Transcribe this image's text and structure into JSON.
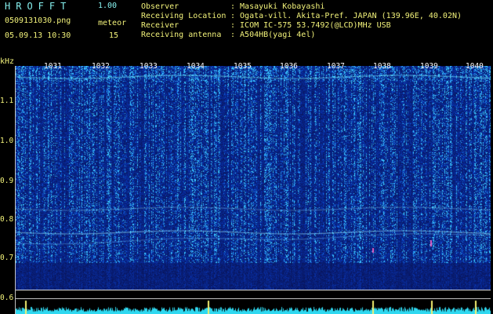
{
  "header": {
    "title": "HROFFT",
    "version": "1.00",
    "filename": "0509131030.png",
    "meteor_label": "meteor",
    "datetime": "05.09.13 10:30",
    "meteor_count": "15"
  },
  "info": {
    "observer_label": "Observer",
    "observer_value": ": Masayuki Kobayashi",
    "location_label": "Receiving Location",
    "location_value": ": Ogata-vill. Akita-Pref. JAPAN (139.96E, 40.02N)",
    "receiver_label": "Receiver",
    "receiver_value": ": ICOM IC-575 53.7492(@LCD)MHz USB",
    "antenna_label": "Receiving antenna",
    "antenna_value": ": A504HB(yagi 4el)"
  },
  "axis": {
    "y_unit": "kHz",
    "y_ticks": [
      "1.1",
      "1.0",
      "0.9",
      "0.8",
      "0.7",
      "0.6"
    ],
    "x_ticks": [
      "1031",
      "1032",
      "1033",
      "1034",
      "1035",
      "1036",
      "1037",
      "1038",
      "1039",
      "1040"
    ]
  },
  "colors": {
    "background": "#000000",
    "spectrum_bg": "#0d1a8a",
    "noise_cyan": "#3ff0ff",
    "text_cyan": "#7fe8e8",
    "text_yellow": "#f2f27a",
    "meteor_pink": "#ff66cc"
  }
}
